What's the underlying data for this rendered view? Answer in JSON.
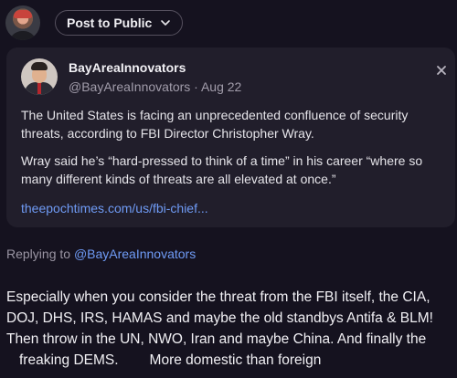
{
  "composer": {
    "audience_label": "Post to Public",
    "avatar_icon": "user-avatar"
  },
  "quoted_post": {
    "display_name": "BayAreaInnovators",
    "handle": "@BayAreaInnovators",
    "separator": "·",
    "date": "Aug 22",
    "paragraphs": [
      "The United States is facing an unprecedented confluence of security threats, according to FBI Director Christopher Wray.",
      "Wray said he’s “hard-pressed to think of a time” in his career “where so many different kinds of threats are all elevated at once.”"
    ],
    "link_text": "theepochtimes.com/us/fbi-chief...",
    "close_icon": "close-icon"
  },
  "reply": {
    "replying_prefix": "Replying to",
    "replying_handle": "@BayAreaInnovators",
    "lines": [
      "Especially when you consider the threat from the FBI itself, the CIA,",
      "DOJ, DHS, IRS, HAMAS and maybe the old standbys Antifa & BLM!",
      "Then throw in the UN, NWO, Iran and maybe China. And finally the",
      "freaking DEMS.",
      "More domestic than foreign"
    ]
  },
  "colors": {
    "background": "#15121f",
    "card": "#211e2b",
    "link": "#6f9bf5",
    "muted_text": "#9a95a3"
  }
}
